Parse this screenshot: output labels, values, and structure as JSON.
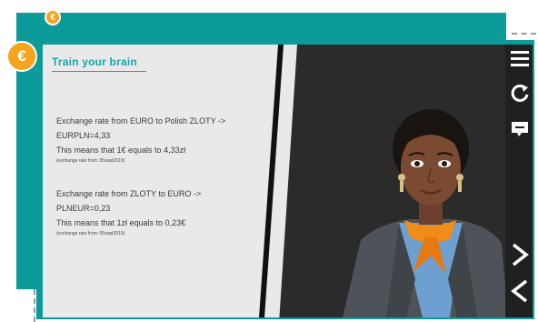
{
  "colors": {
    "teal": "#0d9b9a",
    "title_teal": "#1aa6a6",
    "coin": "#f4a51c",
    "panel": "#e9e9ea",
    "scene": "#2b2b2b"
  },
  "coin_symbol": "€",
  "panel": {
    "title": "Train your brain",
    "block1": {
      "line1": "Exchange rate from EURO to Polish ZLOTY ->",
      "line2": "EURPLN=4,33",
      "line3": "This means that 1€ equals to 4,33zł",
      "source": "(exchange rate from: 05sept2019)"
    },
    "block2": {
      "line1": "Exchange rate from ZLOTY to EURO ->",
      "line2": "PLNEUR=0,23",
      "line3": "This means that 1zł equals to 0,23€",
      "source": "(exchange rate from: 05sept2019)"
    }
  },
  "toolbar_icons": [
    "menu-icon",
    "restart-icon",
    "subtitles-icon",
    "next-icon",
    "previous-icon"
  ]
}
